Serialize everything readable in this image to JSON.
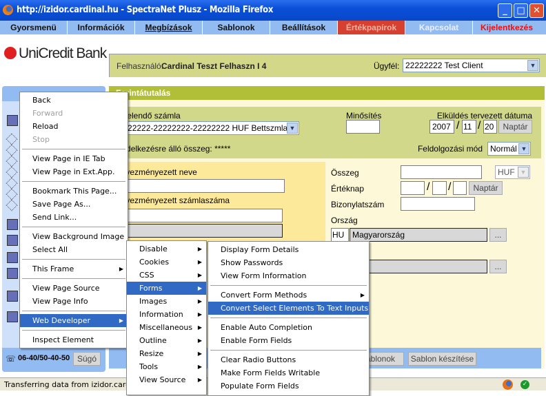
{
  "window": {
    "title": "http://izidor.cardinal.hu - SpectraNet Plusz - Mozilla Firefox"
  },
  "nav": [
    {
      "label": "Gyorsmenü",
      "style": ""
    },
    {
      "label": "Információk",
      "style": ""
    },
    {
      "label": "Megbízások",
      "style": "ul"
    },
    {
      "label": "Sablonok",
      "style": ""
    },
    {
      "label": "Beállítások",
      "style": ""
    },
    {
      "label": "Értékpapírok",
      "style": "red"
    },
    {
      "label": "Kapcsolat",
      "style": "light"
    },
    {
      "label": "Kijelentkezés",
      "style": "exit"
    }
  ],
  "logo": "UniCredit Bank",
  "userbar": {
    "user_label": "Felhasználó:",
    "user_name": "Cardinal Teszt Felhaszn I 4",
    "client_label": "Ügyfél:",
    "client_value": "22222222 Test Client"
  },
  "form": {
    "title": "Forintátutalás",
    "debit_label": "Terhelendő számla",
    "debit_value": "22222222-22222222-22222222 HUF Bettszmla 2",
    "rating_label": "Minősítés",
    "rating_value": "",
    "send_date_label": "Elküldés tervezett dátuma",
    "year": "2007",
    "month": "11",
    "day": "20",
    "calendar": "Naptár",
    "available_label": "Rendelkezésre álló összeg: *****",
    "mode_label": "Feldolgozási mód",
    "mode_value": "Normál",
    "payee_name_label": "Kedvezményezett neve",
    "payee_account_label": "Kedvezményezett számlaszáma",
    "amount_label": "Összeg",
    "currency": "HUF",
    "value_date_label": "Értéknap",
    "value_date_calendar": "Naptár",
    "doc_number_label": "Bizonylatszám",
    "country_label": "Ország",
    "country_code": "HU",
    "country_name": "Magyarország",
    "browse": "...",
    "templates_button": "Sablonok",
    "create_template_button": "Sablon készítése"
  },
  "sidebar": {
    "phone": "06-40/50-40-50",
    "help": "Súgó"
  },
  "context_menu": [
    {
      "label": "Back"
    },
    {
      "label": "Forward",
      "disabled": true
    },
    {
      "label": "Reload"
    },
    {
      "label": "Stop",
      "disabled": true
    },
    {
      "sep": true
    },
    {
      "label": "View Page in IE Tab"
    },
    {
      "label": "View Page in Ext.App."
    },
    {
      "sep": true
    },
    {
      "label": "Bookmark This Page..."
    },
    {
      "label": "Save Page As..."
    },
    {
      "label": "Send Link..."
    },
    {
      "sep": true
    },
    {
      "label": "View Background Image"
    },
    {
      "label": "Select All"
    },
    {
      "sep": true
    },
    {
      "label": "This Frame",
      "sub": true
    },
    {
      "sep": true
    },
    {
      "label": "View Page Source"
    },
    {
      "label": "View Page Info"
    },
    {
      "sep": true
    },
    {
      "label": "Web Developer",
      "sub": true,
      "hl": true
    },
    {
      "sep": true
    },
    {
      "label": "Inspect Element"
    }
  ],
  "webdev_menu": [
    {
      "label": "Disable",
      "sub": true
    },
    {
      "label": "Cookies",
      "sub": true
    },
    {
      "label": "CSS",
      "sub": true
    },
    {
      "label": "Forms",
      "sub": true,
      "hl": true
    },
    {
      "label": "Images",
      "sub": true
    },
    {
      "label": "Information",
      "sub": true
    },
    {
      "label": "Miscellaneous",
      "sub": true
    },
    {
      "label": "Outline",
      "sub": true
    },
    {
      "label": "Resize",
      "sub": true
    },
    {
      "label": "Tools",
      "sub": true
    },
    {
      "label": "View Source",
      "sub": true
    }
  ],
  "forms_menu": [
    {
      "label": "Display Form Details"
    },
    {
      "label": "Show Passwords"
    },
    {
      "label": "View Form Information"
    },
    {
      "sep": true
    },
    {
      "label": "Convert Form Methods",
      "sub": true
    },
    {
      "label": "Convert Select Elements To Text Inputs",
      "hl": true
    },
    {
      "sep": true
    },
    {
      "label": "Enable Auto Completion"
    },
    {
      "label": "Enable Form Fields"
    },
    {
      "sep": true
    },
    {
      "label": "Clear Radio Buttons"
    },
    {
      "label": "Make Form Fields Writable"
    },
    {
      "label": "Populate Form Fields"
    }
  ],
  "status": {
    "text": "Transferring data from izidor.cardinal.hu..."
  }
}
